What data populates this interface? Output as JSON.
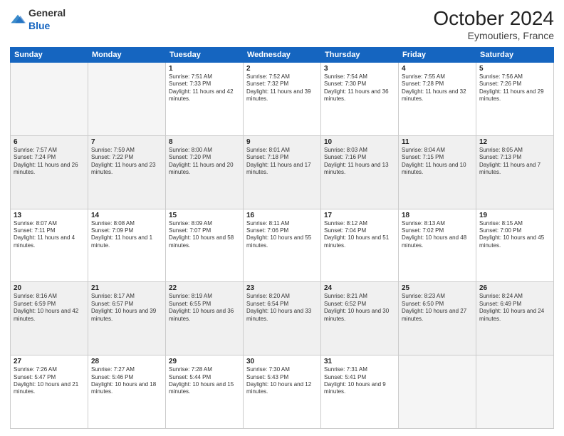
{
  "header": {
    "logo": {
      "general": "General",
      "blue": "Blue"
    },
    "title": "October 2024",
    "location": "Eymoutiers, France"
  },
  "weekdays": [
    "Sunday",
    "Monday",
    "Tuesday",
    "Wednesday",
    "Thursday",
    "Friday",
    "Saturday"
  ],
  "weeks": [
    [
      {
        "day": "",
        "info": ""
      },
      {
        "day": "",
        "info": ""
      },
      {
        "day": "1",
        "info": "Sunrise: 7:51 AM\nSunset: 7:33 PM\nDaylight: 11 hours and 42 minutes."
      },
      {
        "day": "2",
        "info": "Sunrise: 7:52 AM\nSunset: 7:32 PM\nDaylight: 11 hours and 39 minutes."
      },
      {
        "day": "3",
        "info": "Sunrise: 7:54 AM\nSunset: 7:30 PM\nDaylight: 11 hours and 36 minutes."
      },
      {
        "day": "4",
        "info": "Sunrise: 7:55 AM\nSunset: 7:28 PM\nDaylight: 11 hours and 32 minutes."
      },
      {
        "day": "5",
        "info": "Sunrise: 7:56 AM\nSunset: 7:26 PM\nDaylight: 11 hours and 29 minutes."
      }
    ],
    [
      {
        "day": "6",
        "info": "Sunrise: 7:57 AM\nSunset: 7:24 PM\nDaylight: 11 hours and 26 minutes."
      },
      {
        "day": "7",
        "info": "Sunrise: 7:59 AM\nSunset: 7:22 PM\nDaylight: 11 hours and 23 minutes."
      },
      {
        "day": "8",
        "info": "Sunrise: 8:00 AM\nSunset: 7:20 PM\nDaylight: 11 hours and 20 minutes."
      },
      {
        "day": "9",
        "info": "Sunrise: 8:01 AM\nSunset: 7:18 PM\nDaylight: 11 hours and 17 minutes."
      },
      {
        "day": "10",
        "info": "Sunrise: 8:03 AM\nSunset: 7:16 PM\nDaylight: 11 hours and 13 minutes."
      },
      {
        "day": "11",
        "info": "Sunrise: 8:04 AM\nSunset: 7:15 PM\nDaylight: 11 hours and 10 minutes."
      },
      {
        "day": "12",
        "info": "Sunrise: 8:05 AM\nSunset: 7:13 PM\nDaylight: 11 hours and 7 minutes."
      }
    ],
    [
      {
        "day": "13",
        "info": "Sunrise: 8:07 AM\nSunset: 7:11 PM\nDaylight: 11 hours and 4 minutes."
      },
      {
        "day": "14",
        "info": "Sunrise: 8:08 AM\nSunset: 7:09 PM\nDaylight: 11 hours and 1 minute."
      },
      {
        "day": "15",
        "info": "Sunrise: 8:09 AM\nSunset: 7:07 PM\nDaylight: 10 hours and 58 minutes."
      },
      {
        "day": "16",
        "info": "Sunrise: 8:11 AM\nSunset: 7:06 PM\nDaylight: 10 hours and 55 minutes."
      },
      {
        "day": "17",
        "info": "Sunrise: 8:12 AM\nSunset: 7:04 PM\nDaylight: 10 hours and 51 minutes."
      },
      {
        "day": "18",
        "info": "Sunrise: 8:13 AM\nSunset: 7:02 PM\nDaylight: 10 hours and 48 minutes."
      },
      {
        "day": "19",
        "info": "Sunrise: 8:15 AM\nSunset: 7:00 PM\nDaylight: 10 hours and 45 minutes."
      }
    ],
    [
      {
        "day": "20",
        "info": "Sunrise: 8:16 AM\nSunset: 6:59 PM\nDaylight: 10 hours and 42 minutes."
      },
      {
        "day": "21",
        "info": "Sunrise: 8:17 AM\nSunset: 6:57 PM\nDaylight: 10 hours and 39 minutes."
      },
      {
        "day": "22",
        "info": "Sunrise: 8:19 AM\nSunset: 6:55 PM\nDaylight: 10 hours and 36 minutes."
      },
      {
        "day": "23",
        "info": "Sunrise: 8:20 AM\nSunset: 6:54 PM\nDaylight: 10 hours and 33 minutes."
      },
      {
        "day": "24",
        "info": "Sunrise: 8:21 AM\nSunset: 6:52 PM\nDaylight: 10 hours and 30 minutes."
      },
      {
        "day": "25",
        "info": "Sunrise: 8:23 AM\nSunset: 6:50 PM\nDaylight: 10 hours and 27 minutes."
      },
      {
        "day": "26",
        "info": "Sunrise: 8:24 AM\nSunset: 6:49 PM\nDaylight: 10 hours and 24 minutes."
      }
    ],
    [
      {
        "day": "27",
        "info": "Sunrise: 7:26 AM\nSunset: 5:47 PM\nDaylight: 10 hours and 21 minutes."
      },
      {
        "day": "28",
        "info": "Sunrise: 7:27 AM\nSunset: 5:46 PM\nDaylight: 10 hours and 18 minutes."
      },
      {
        "day": "29",
        "info": "Sunrise: 7:28 AM\nSunset: 5:44 PM\nDaylight: 10 hours and 15 minutes."
      },
      {
        "day": "30",
        "info": "Sunrise: 7:30 AM\nSunset: 5:43 PM\nDaylight: 10 hours and 12 minutes."
      },
      {
        "day": "31",
        "info": "Sunrise: 7:31 AM\nSunset: 5:41 PM\nDaylight: 10 hours and 9 minutes."
      },
      {
        "day": "",
        "info": ""
      },
      {
        "day": "",
        "info": ""
      }
    ]
  ]
}
